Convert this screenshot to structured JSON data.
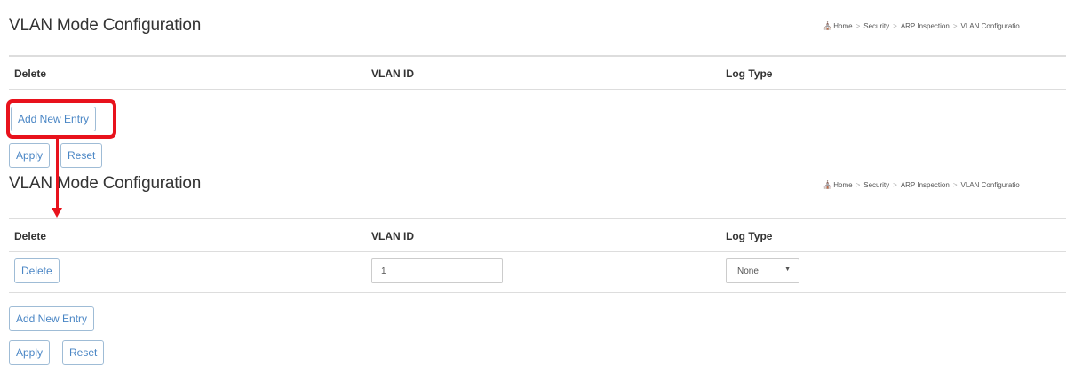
{
  "breadcrumb": {
    "items": [
      "Home",
      "Security",
      "ARP Inspection",
      "VLAN Configuratio"
    ],
    "separator": ">"
  },
  "top_panel": {
    "title": "VLAN Mode Configuration",
    "columns": [
      "Delete",
      "VLAN ID",
      "Log Type"
    ],
    "buttons": {
      "add_new_entry": "Add New Entry",
      "apply": "Apply",
      "reset": "Reset"
    }
  },
  "bottom_panel": {
    "title": "VLAN Mode Configuration",
    "columns": [
      "Delete",
      "VLAN ID",
      "Log Type"
    ],
    "rows": [
      {
        "delete_label": "Delete",
        "vlan_id": "1",
        "log_type": "None"
      }
    ],
    "buttons": {
      "add_new_entry": "Add New Entry",
      "apply": "Apply",
      "reset": "Reset"
    }
  },
  "annotation": {
    "color": "#e8121c"
  },
  "colors": {
    "link_blue": "#4a86c5",
    "border": "#dddddd"
  }
}
